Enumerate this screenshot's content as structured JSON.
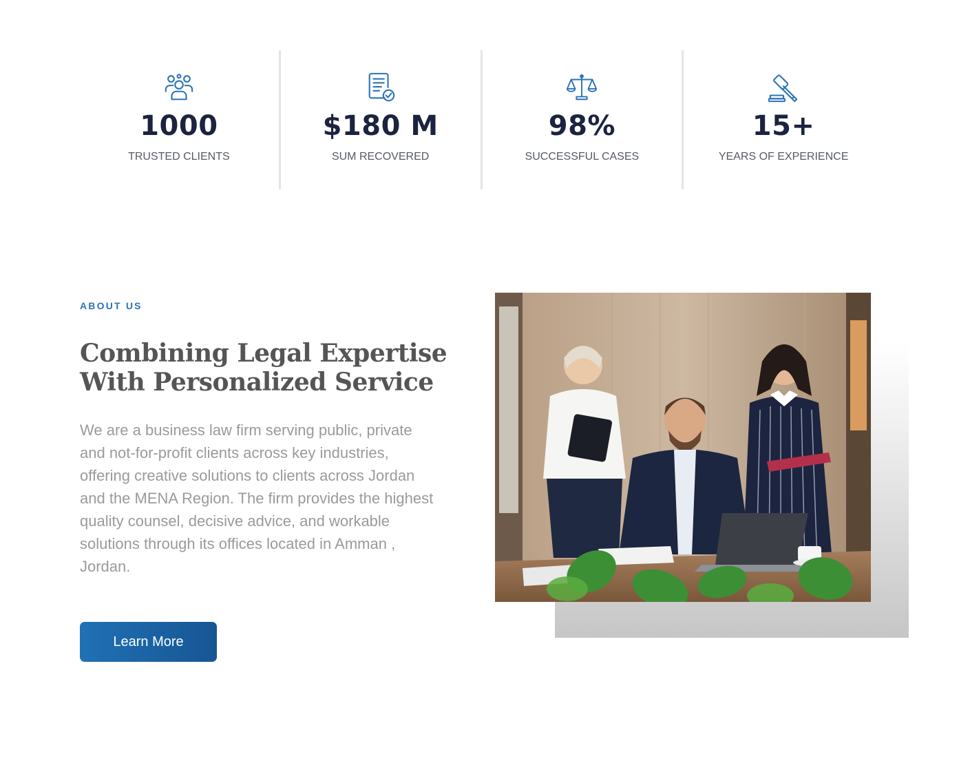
{
  "stats": [
    {
      "icon": "users-icon",
      "value": "1000",
      "label": "TRUSTED CLIENTS"
    },
    {
      "icon": "document-check-icon",
      "value": "$180 M",
      "label": "SUM RECOVERED"
    },
    {
      "icon": "scales-of-justice-icon",
      "value": "98%",
      "label": "SUCCESSFUL CASES"
    },
    {
      "icon": "gavel-icon",
      "value": "15+",
      "label": "YEARS OF EXPERIENCE"
    }
  ],
  "about": {
    "eyebrow": "ABOUT US",
    "title": "Combining Legal Expertise With Personalized Service",
    "body": "We are a  business law firm serving public, private and not-for-profit clients across key industries, offering creative solutions to clients across Jordan and the MENA Region. The firm provides the highest quality counsel, decisive advice, and workable solutions through its offices located in Amman , Jordan.",
    "button_label": "Learn More"
  },
  "colors": {
    "accent": "#2a73b8",
    "button": "#1a63a6",
    "stat_value": "#1c2340"
  }
}
